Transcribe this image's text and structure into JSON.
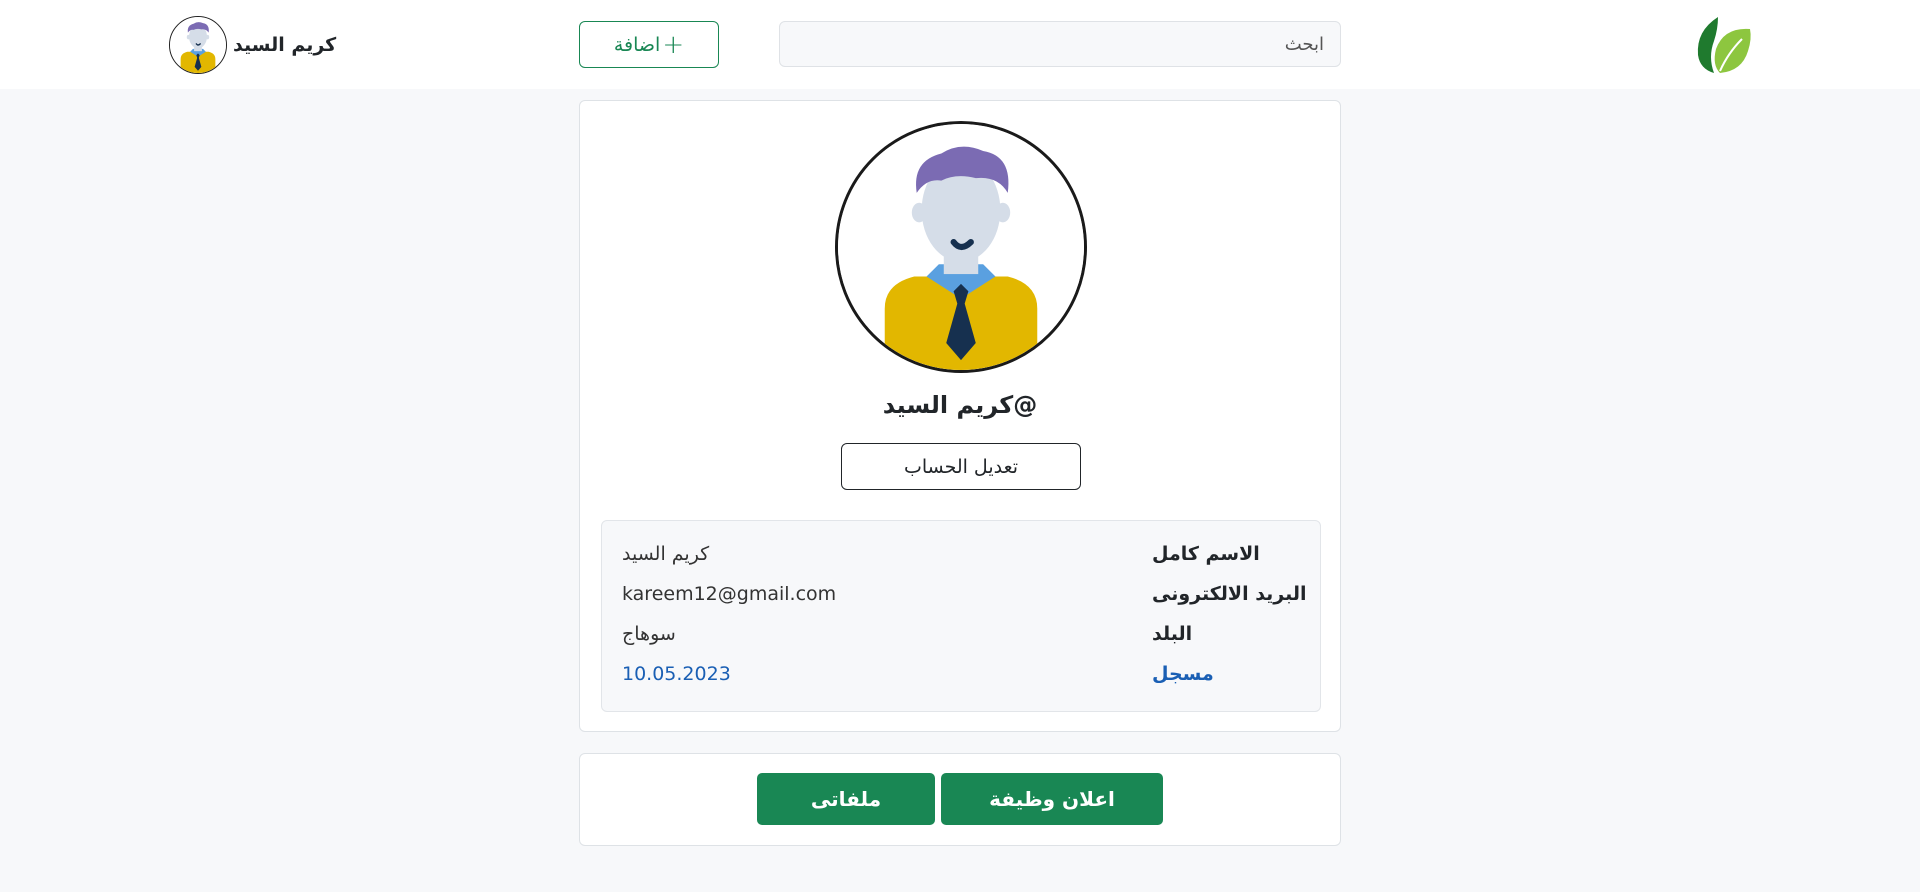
{
  "header": {
    "logo_icon": "leaf-logo-icon",
    "search_placeholder": "ابحث",
    "add_button_label": "اضافة",
    "add_icon": "+",
    "user_name": "كريم السيد"
  },
  "profile": {
    "handle": "@كريم السيد",
    "edit_button_label": "تعديل الحساب",
    "details": [
      {
        "label": "الاسم كامل",
        "value": "كريم السيد"
      },
      {
        "label": "البريد الالكترونى",
        "value": "kareem12@gmail.com"
      },
      {
        "label": "البلد",
        "value": "سوهاج"
      },
      {
        "label": "مسجل",
        "value": "10.05.2023"
      }
    ]
  },
  "actions": {
    "post_job_label": "اعلان وظيفة",
    "my_files_label": "ملفاتى"
  },
  "colors": {
    "primary_green": "#198754",
    "link_blue": "#1a5fb4",
    "page_bg": "#f7f8fa"
  }
}
